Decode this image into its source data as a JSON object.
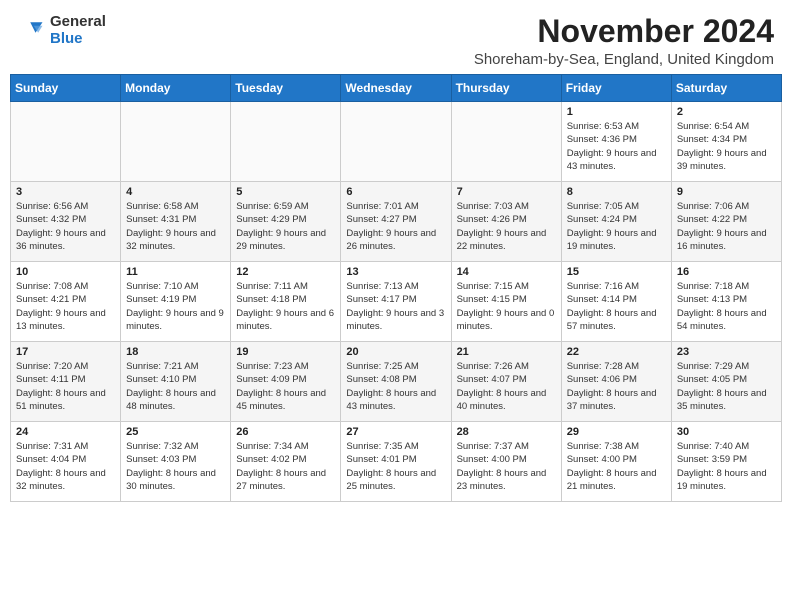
{
  "logo": {
    "general": "General",
    "blue": "Blue"
  },
  "header": {
    "month": "November 2024",
    "location": "Shoreham-by-Sea, England, United Kingdom"
  },
  "weekdays": [
    "Sunday",
    "Monday",
    "Tuesday",
    "Wednesday",
    "Thursday",
    "Friday",
    "Saturday"
  ],
  "weeks": [
    [
      {
        "day": "",
        "info": ""
      },
      {
        "day": "",
        "info": ""
      },
      {
        "day": "",
        "info": ""
      },
      {
        "day": "",
        "info": ""
      },
      {
        "day": "",
        "info": ""
      },
      {
        "day": "1",
        "info": "Sunrise: 6:53 AM\nSunset: 4:36 PM\nDaylight: 9 hours and 43 minutes."
      },
      {
        "day": "2",
        "info": "Sunrise: 6:54 AM\nSunset: 4:34 PM\nDaylight: 9 hours and 39 minutes."
      }
    ],
    [
      {
        "day": "3",
        "info": "Sunrise: 6:56 AM\nSunset: 4:32 PM\nDaylight: 9 hours and 36 minutes."
      },
      {
        "day": "4",
        "info": "Sunrise: 6:58 AM\nSunset: 4:31 PM\nDaylight: 9 hours and 32 minutes."
      },
      {
        "day": "5",
        "info": "Sunrise: 6:59 AM\nSunset: 4:29 PM\nDaylight: 9 hours and 29 minutes."
      },
      {
        "day": "6",
        "info": "Sunrise: 7:01 AM\nSunset: 4:27 PM\nDaylight: 9 hours and 26 minutes."
      },
      {
        "day": "7",
        "info": "Sunrise: 7:03 AM\nSunset: 4:26 PM\nDaylight: 9 hours and 22 minutes."
      },
      {
        "day": "8",
        "info": "Sunrise: 7:05 AM\nSunset: 4:24 PM\nDaylight: 9 hours and 19 minutes."
      },
      {
        "day": "9",
        "info": "Sunrise: 7:06 AM\nSunset: 4:22 PM\nDaylight: 9 hours and 16 minutes."
      }
    ],
    [
      {
        "day": "10",
        "info": "Sunrise: 7:08 AM\nSunset: 4:21 PM\nDaylight: 9 hours and 13 minutes."
      },
      {
        "day": "11",
        "info": "Sunrise: 7:10 AM\nSunset: 4:19 PM\nDaylight: 9 hours and 9 minutes."
      },
      {
        "day": "12",
        "info": "Sunrise: 7:11 AM\nSunset: 4:18 PM\nDaylight: 9 hours and 6 minutes."
      },
      {
        "day": "13",
        "info": "Sunrise: 7:13 AM\nSunset: 4:17 PM\nDaylight: 9 hours and 3 minutes."
      },
      {
        "day": "14",
        "info": "Sunrise: 7:15 AM\nSunset: 4:15 PM\nDaylight: 9 hours and 0 minutes."
      },
      {
        "day": "15",
        "info": "Sunrise: 7:16 AM\nSunset: 4:14 PM\nDaylight: 8 hours and 57 minutes."
      },
      {
        "day": "16",
        "info": "Sunrise: 7:18 AM\nSunset: 4:13 PM\nDaylight: 8 hours and 54 minutes."
      }
    ],
    [
      {
        "day": "17",
        "info": "Sunrise: 7:20 AM\nSunset: 4:11 PM\nDaylight: 8 hours and 51 minutes."
      },
      {
        "day": "18",
        "info": "Sunrise: 7:21 AM\nSunset: 4:10 PM\nDaylight: 8 hours and 48 minutes."
      },
      {
        "day": "19",
        "info": "Sunrise: 7:23 AM\nSunset: 4:09 PM\nDaylight: 8 hours and 45 minutes."
      },
      {
        "day": "20",
        "info": "Sunrise: 7:25 AM\nSunset: 4:08 PM\nDaylight: 8 hours and 43 minutes."
      },
      {
        "day": "21",
        "info": "Sunrise: 7:26 AM\nSunset: 4:07 PM\nDaylight: 8 hours and 40 minutes."
      },
      {
        "day": "22",
        "info": "Sunrise: 7:28 AM\nSunset: 4:06 PM\nDaylight: 8 hours and 37 minutes."
      },
      {
        "day": "23",
        "info": "Sunrise: 7:29 AM\nSunset: 4:05 PM\nDaylight: 8 hours and 35 minutes."
      }
    ],
    [
      {
        "day": "24",
        "info": "Sunrise: 7:31 AM\nSunset: 4:04 PM\nDaylight: 8 hours and 32 minutes."
      },
      {
        "day": "25",
        "info": "Sunrise: 7:32 AM\nSunset: 4:03 PM\nDaylight: 8 hours and 30 minutes."
      },
      {
        "day": "26",
        "info": "Sunrise: 7:34 AM\nSunset: 4:02 PM\nDaylight: 8 hours and 27 minutes."
      },
      {
        "day": "27",
        "info": "Sunrise: 7:35 AM\nSunset: 4:01 PM\nDaylight: 8 hours and 25 minutes."
      },
      {
        "day": "28",
        "info": "Sunrise: 7:37 AM\nSunset: 4:00 PM\nDaylight: 8 hours and 23 minutes."
      },
      {
        "day": "29",
        "info": "Sunrise: 7:38 AM\nSunset: 4:00 PM\nDaylight: 8 hours and 21 minutes."
      },
      {
        "day": "30",
        "info": "Sunrise: 7:40 AM\nSunset: 3:59 PM\nDaylight: 8 hours and 19 minutes."
      }
    ]
  ]
}
